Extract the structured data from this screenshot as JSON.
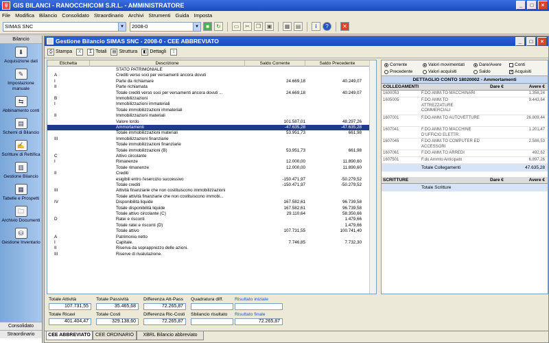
{
  "app": {
    "title": "GIS BILANCI - RANOCCHICOM S.R.L. - AMMINISTRATORE",
    "logo_text": "g"
  },
  "menu": [
    "File",
    "Modifica",
    "Bilancio",
    "Consolidato",
    "Straordinario",
    "Archivi",
    "Strumenti",
    "Guida",
    "Imposta"
  ],
  "toolbar": {
    "company": "SIMAS SNC",
    "period": "2008-0"
  },
  "leftnav": {
    "header": "Bilancio",
    "items": [
      {
        "label": "Acquisizione dati",
        "icon": "acquisition-icon",
        "glyph": "⬇"
      },
      {
        "label": "Impostazione manuale",
        "icon": "manual-edit-icon",
        "glyph": "✎"
      },
      {
        "label": "Abbinamento conti",
        "icon": "link-accounts-icon",
        "glyph": "⇆"
      },
      {
        "label": "Schemi di Bilancio",
        "icon": "schema-icon",
        "glyph": "▤"
      },
      {
        "label": "Scritture di Rettifica",
        "icon": "adjust-icon",
        "glyph": "✍"
      },
      {
        "label": "Gestione Bilancio",
        "icon": "manage-icon",
        "glyph": "▥"
      },
      {
        "label": "Tabelle e Prospetti",
        "icon": "tables-icon",
        "glyph": "▦"
      },
      {
        "label": "Archivio Documenti",
        "icon": "archive-icon",
        "glyph": "🗀"
      },
      {
        "label": "Gestione Inventario",
        "icon": "inventory-icon",
        "glyph": "⛁"
      }
    ],
    "footer1": "Consolidato",
    "footer2": "Straordinario"
  },
  "inner": {
    "title": "Gestione Bilancio SIMAS SNC - 2008-0 - CEE ABBREVIATO",
    "tools": [
      "Stampa",
      "Totali",
      "Struttura",
      "Dettagli"
    ]
  },
  "grid": {
    "columns": [
      "Etichetta",
      "Descrizione",
      "Saldo Corrente",
      "Saldo Precedente"
    ],
    "rows": [
      {
        "e": "",
        "d": "STATO PATRIMONIALE",
        "c": "",
        "p": ""
      },
      {
        "e": "A",
        "d": "Crediti verso soci per versamenti ancora dovuti",
        "c": "",
        "p": ""
      },
      {
        "e": "I",
        "d": "Parte da richiamare",
        "c": "24.669,18",
        "p": "40.249,07"
      },
      {
        "e": "II",
        "d": "Parte richiamata",
        "c": "",
        "p": ""
      },
      {
        "e": "",
        "d": "Totale crediti verso soci per versamenti ancora dovuti ...",
        "c": "24.669,18",
        "p": "40.249,07"
      },
      {
        "e": "B",
        "d": "Immobilizzazioni",
        "c": "",
        "p": ""
      },
      {
        "e": "I",
        "d": "Immobilizzazioni immateriali",
        "c": "",
        "p": ""
      },
      {
        "e": "",
        "d": "Totale immobilizzazioni immateriali",
        "c": "",
        "p": ""
      },
      {
        "e": "II",
        "d": "Immobilizzazioni materiali",
        "c": "",
        "p": ""
      },
      {
        "e": "",
        "d": "Valore lordo",
        "c": "101.587,01",
        "p": "48.297,26"
      },
      {
        "e": "",
        "d": "Ammortamenti",
        "c": "-47.635,28",
        "p": "-47.635,28",
        "sel": true
      },
      {
        "e": "",
        "d": "Totale immobilizzazioni materiali",
        "c": "53.951,73",
        "p": "661,98"
      },
      {
        "e": "III",
        "d": "Immobilizzazioni finanziarie",
        "c": "",
        "p": ""
      },
      {
        "e": "",
        "d": "Totale immobilizzazioni finanziarie",
        "c": "",
        "p": ""
      },
      {
        "e": "",
        "d": "Totale immobilizzazioni (B)",
        "c": "53.951,73",
        "p": "661,98"
      },
      {
        "e": "C",
        "d": "Attivo circolante",
        "c": "",
        "p": ""
      },
      {
        "e": "I",
        "d": "Rimanenze",
        "c": "12.000,00",
        "p": "11.890,60"
      },
      {
        "e": "",
        "d": "Totale rimanenze",
        "c": "12.000,00",
        "p": "11.890,60"
      },
      {
        "e": "II",
        "d": "Crediti",
        "c": "",
        "p": ""
      },
      {
        "e": "",
        "d": "esigibili entro l'esercizio successivo",
        "c": "-150.471,97",
        "p": "-50.279,52"
      },
      {
        "e": "",
        "d": "Totale crediti",
        "c": "-150.471,97",
        "p": "-50.279,52"
      },
      {
        "e": "III",
        "d": "Attività finanziarie che non costituiscono immobilizzazioni",
        "c": "",
        "p": ""
      },
      {
        "e": "",
        "d": "Totale attività finanziarie che non costituiscono immobi...",
        "c": "",
        "p": ""
      },
      {
        "e": "IV",
        "d": "Disponibilità liquide",
        "c": "167.582,61",
        "p": "96.739,58"
      },
      {
        "e": "",
        "d": "Totale disponibilità liquide",
        "c": "167.582,61",
        "p": "96.739,58"
      },
      {
        "e": "",
        "d": "Totale attivo circolante (C)",
        "c": "29.110,64",
        "p": "58.350,66"
      },
      {
        "e": "D",
        "d": "Ratei e risconti",
        "c": "",
        "p": "1.479,66"
      },
      {
        "e": "",
        "d": "Totale ratei e risconti (D)",
        "c": "",
        "p": "1.479,66"
      },
      {
        "e": "",
        "d": "Totale attivo",
        "c": "107.731,55",
        "p": "100.741,40"
      },
      {
        "e": "A",
        "d": "Patrimonio netto",
        "c": "",
        "p": ""
      },
      {
        "e": "I",
        "d": "Capitale.",
        "c": "7.746,85",
        "p": "7.732,30"
      },
      {
        "e": "II",
        "d": "Riserva da soprapprezzo delle azioni.",
        "c": "",
        "p": ""
      },
      {
        "e": "III",
        "d": "Riserve di rivalutazione.",
        "c": "",
        "p": ""
      }
    ]
  },
  "options": [
    {
      "label": "Corrente",
      "type": "radio",
      "on": true
    },
    {
      "label": "Valori movimentati",
      "type": "radio",
      "on": true
    },
    {
      "label": "Dare/Avere",
      "type": "radio",
      "on": true
    },
    {
      "label": "Conti",
      "type": "check",
      "on": false
    },
    {
      "label": "Precedente",
      "type": "radio",
      "on": false
    },
    {
      "label": "Valori acquisiti",
      "type": "radio",
      "on": false
    },
    {
      "label": "Saldo",
      "type": "radio",
      "on": false
    },
    {
      "label": "Acquisiti",
      "type": "check",
      "on": true
    }
  ],
  "detail": {
    "title": "DETTAGLIO CONTO 18020002 - Ammortamenti",
    "collegamenti": {
      "label": "COLLEGAMENTI",
      "dare": "Dare €",
      "avere": "Avere €"
    },
    "rows": [
      {
        "k": "1600053",
        "d": "F.DO AMM.TO MACCHINARI",
        "a": "1.358,24"
      },
      {
        "k": "1605005",
        "d": "F.DO AMM.TO ATTREZZATURE COMMERCIALI",
        "a": "9.443,64"
      },
      {
        "k": "1607001",
        "d": "F.DO AMM.TO AUTOVETTURE",
        "a": "26.809,44"
      },
      {
        "k": "1607041",
        "d": "F.DO AMM.TO MACCHINE D'UFFICIO ELETTR.",
        "a": "1.201,47"
      },
      {
        "k": "1607045",
        "d": "F.DO AMM.TO COMPUTER ED ACCESSORI",
        "a": "2.586,53"
      },
      {
        "k": "1607061",
        "d": "F.DO AMM.TO ARREDI",
        "a": "492,62"
      },
      {
        "k": "1607501",
        "d": "F.do Ammto Anticipato",
        "a": "6.897,26"
      }
    ],
    "tot_coll_label": "Totale Collegamenti",
    "tot_coll": "47.635,28",
    "scritture": {
      "label": "SCRITTURE",
      "dare": "Dare €",
      "avere": "Avere €"
    },
    "tot_scr_label": "Totale Scritture"
  },
  "summary": {
    "tot_attivita": {
      "label": "Totale Attività",
      "value": "107.731,55"
    },
    "tot_passivita": {
      "label": "Totale Passività",
      "value": "35.465,68"
    },
    "diff_att_pass": {
      "label": "Differenza Att-Pass",
      "value": "72.265,87"
    },
    "quadratura": {
      "label": "Quadratura diff.",
      "value": ""
    },
    "ris_iniziale": {
      "label": "Risultato iniziale",
      "value": ""
    },
    "tot_ricavi": {
      "label": "Totale Ricavi",
      "value": "401.404,47"
    },
    "tot_costi": {
      "label": "Totale Costi",
      "value": "329.138,60"
    },
    "diff_ric_costi": {
      "label": "Differenza Ric-Costi",
      "value": "72.265,87"
    },
    "sbilancio": {
      "label": "Sbilancio risultato",
      "value": ""
    },
    "ris_finale": {
      "label": "Risultato finale",
      "value": "72.265,87"
    }
  },
  "tabs": [
    "CEE ABBREVIATO",
    "CEE ORDINARIO",
    "XBRL Bilancio abbreviato"
  ]
}
